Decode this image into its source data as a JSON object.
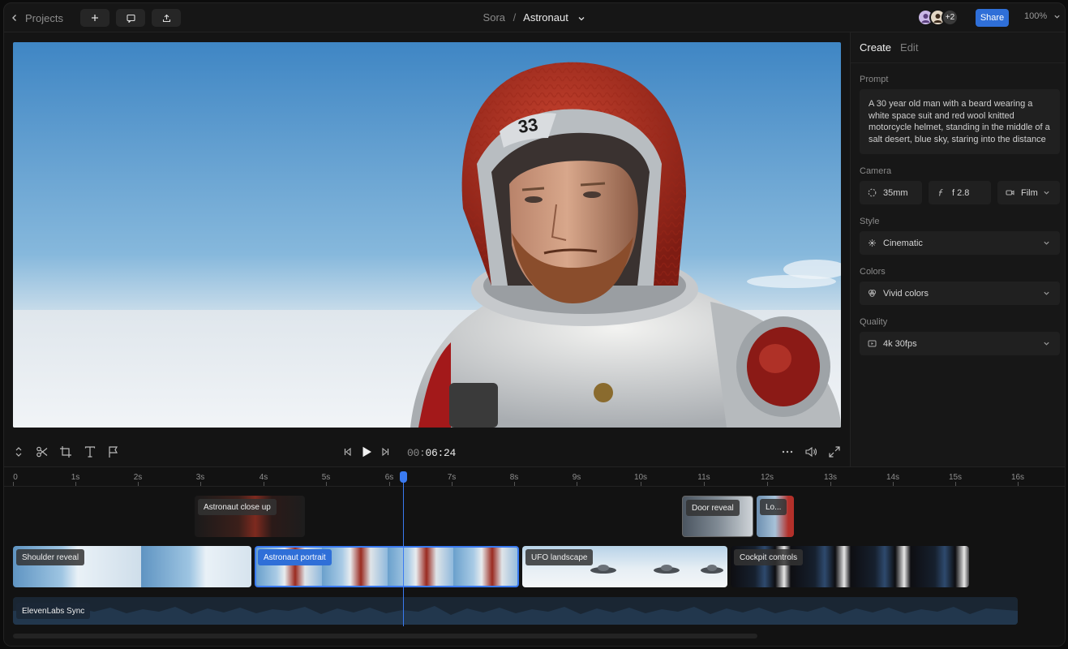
{
  "topbar": {
    "back_label": "Projects",
    "buttons": [
      {
        "name": "add-button",
        "icon": "plus-icon"
      },
      {
        "name": "comment-button",
        "icon": "comment-icon"
      },
      {
        "name": "export-button",
        "icon": "upload-icon"
      }
    ],
    "breadcrumb": {
      "parent": "Sora",
      "separator": "/",
      "current": "Astronaut"
    },
    "avatars_more": "+2",
    "share_label": "Share",
    "zoom": "100%"
  },
  "panel": {
    "tabs": [
      "Create",
      "Edit"
    ],
    "prompt_label": "Prompt",
    "prompt_text": "A 30 year old man with a beard wearing a white space suit and red wool knitted motorcycle helmet, standing in the middle of a salt desert, blue sky, staring into the distance",
    "camera_label": "Camera",
    "camera": {
      "lens": "35mm",
      "aperture": "f 2.8",
      "format": "Film"
    },
    "style_label": "Style",
    "style_value": "Cinematic",
    "colors_label": "Colors",
    "colors_value": "Vivid colors",
    "quality_label": "Quality",
    "quality_value": "4k 30fps"
  },
  "toolbar": {
    "time_dim": "00:",
    "time_main": "06:24"
  },
  "timeline": {
    "ruler": [
      "0",
      "1s",
      "2s",
      "3s",
      "4s",
      "5s",
      "6s",
      "7s",
      "8s",
      "9s",
      "10s",
      "11s",
      "12s",
      "13s",
      "14s",
      "15s",
      "16s"
    ],
    "clips_top": [
      "Astronaut close up",
      "Door reveal",
      "Lo..."
    ],
    "clips_main": [
      "Shoulder reveal",
      "Astronaut portrait",
      "UFO landscape",
      "Cockpit controls"
    ],
    "audio_clip": "ElevenLabs Sync"
  },
  "colors": {
    "accent": "#2f6fd8",
    "playhead": "#3a7af0",
    "background": "#161616"
  }
}
